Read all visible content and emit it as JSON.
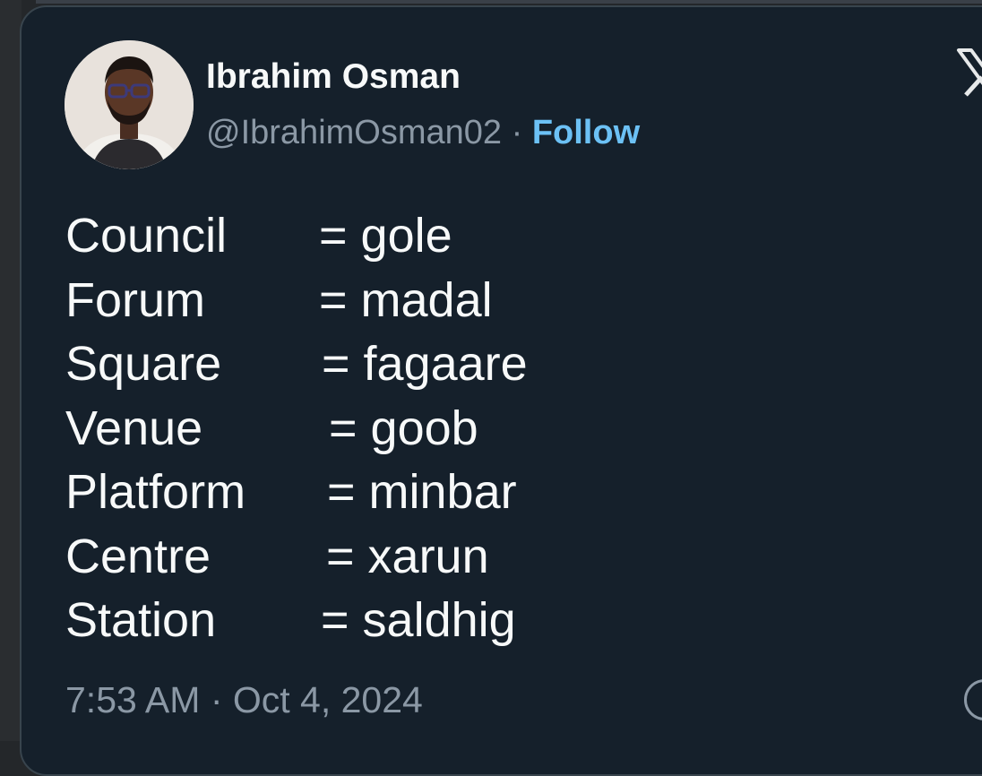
{
  "author": {
    "name": "Ibrahim Osman",
    "handle": "@IbrahimOsman02",
    "separator": "·",
    "follow_label": "Follow"
  },
  "tweet": {
    "lines": [
      {
        "term": "Council",
        "eq": "= gole"
      },
      {
        "term": "Forum",
        "eq": "= madal"
      },
      {
        "term": "Square",
        "eq": "= fagaare"
      },
      {
        "term": "Venue",
        "eq": "= goob"
      },
      {
        "term": "Platform",
        "eq": "= minbar"
      },
      {
        "term": "Centre",
        "eq": "= xarun"
      },
      {
        "term": "Station",
        "eq": "= saldhig"
      }
    ],
    "timestamp": "7:53 AM · Oct 4, 2024"
  },
  "icons": {
    "brand": "x-logo-icon",
    "info": "info-icon"
  },
  "colors": {
    "background": "#15202b",
    "text": "#f7f9f9",
    "muted": "#8b98a5",
    "accent": "#6cc1f5"
  }
}
